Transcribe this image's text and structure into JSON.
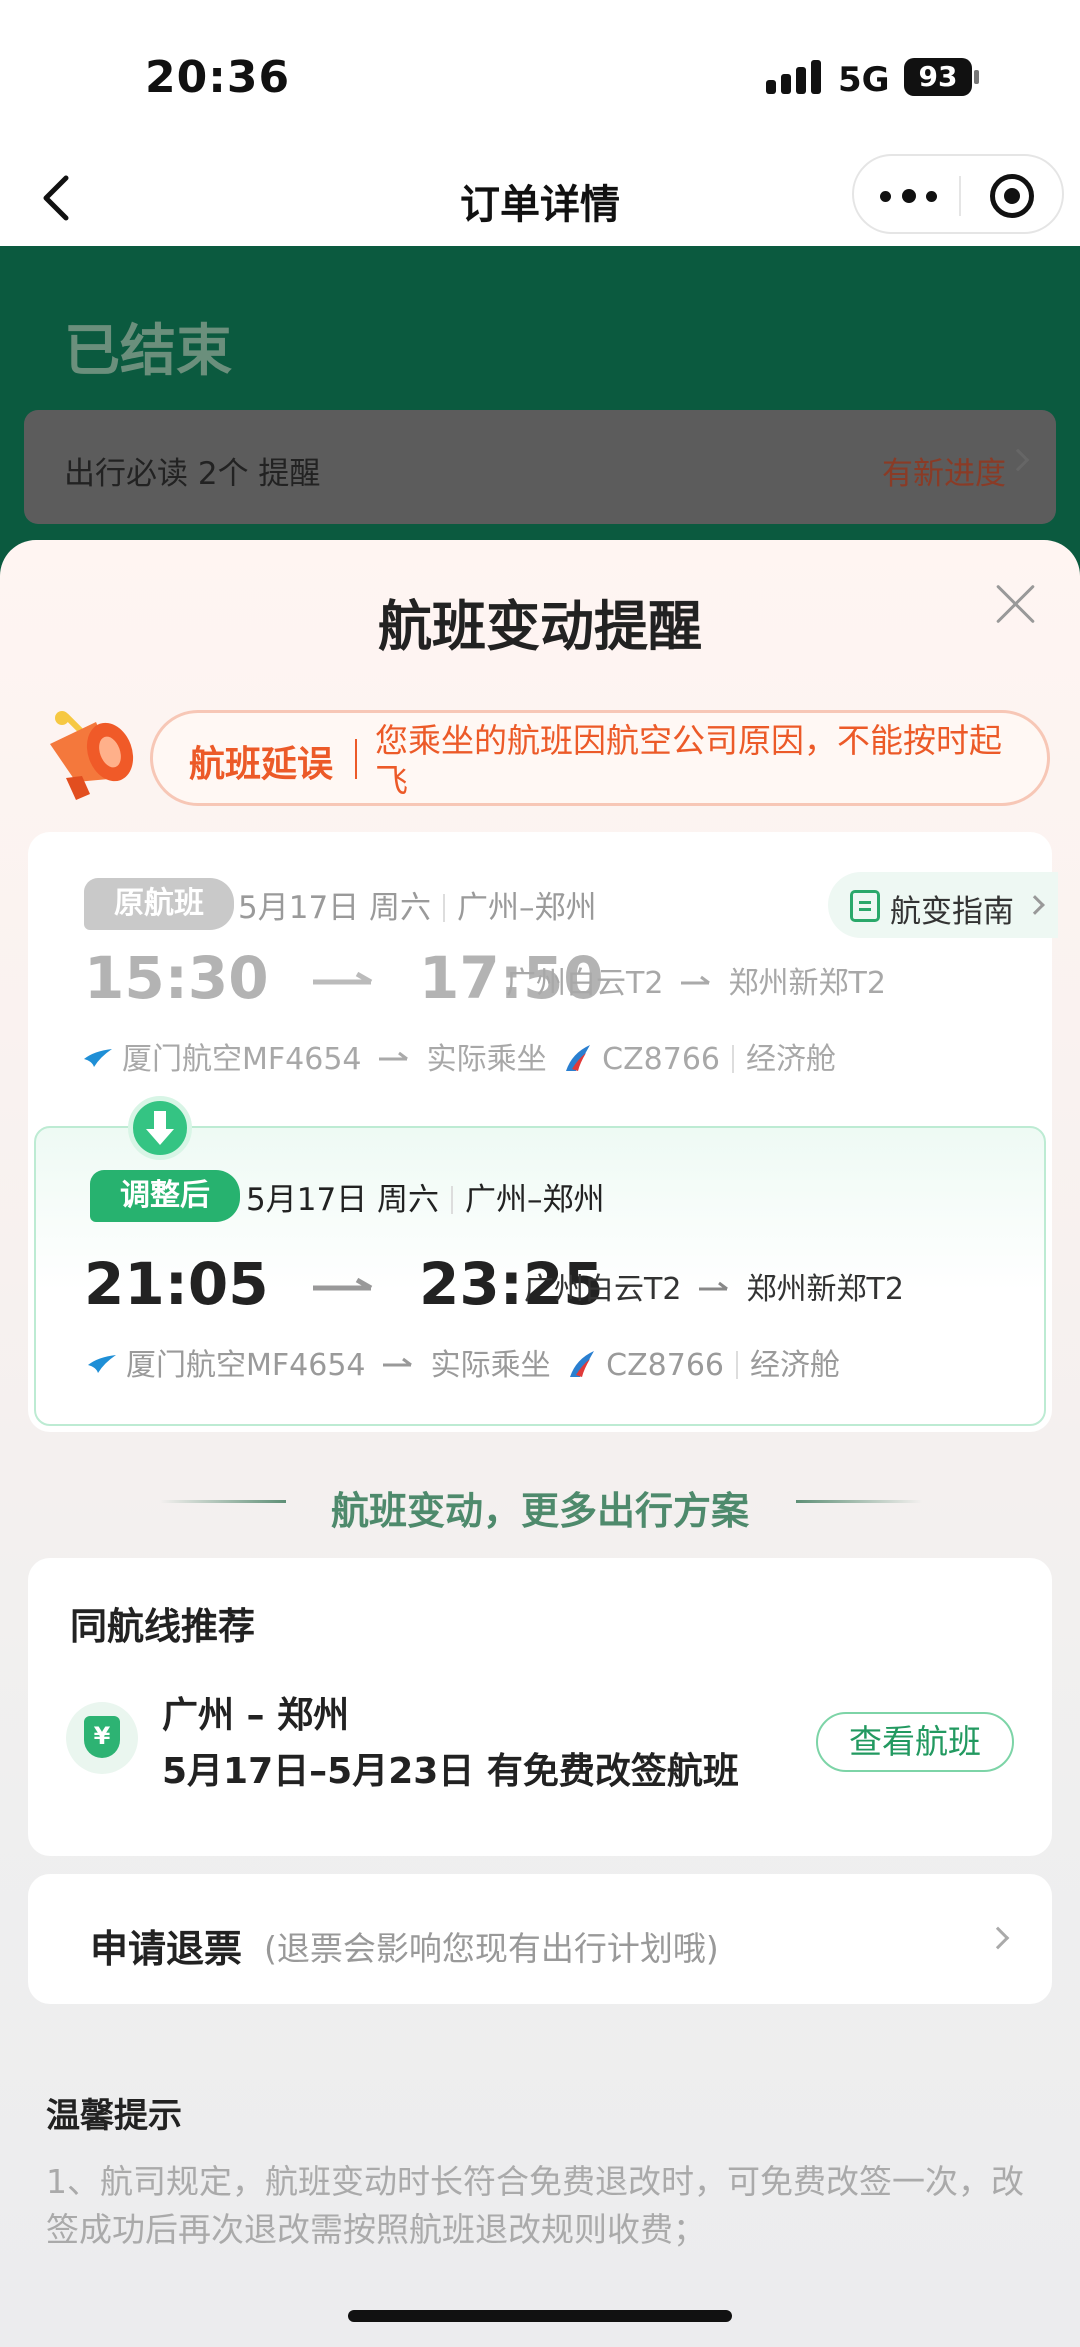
{
  "status_bar": {
    "time": "20:36",
    "network": "5G",
    "battery": "93"
  },
  "nav": {
    "title": "订单详情"
  },
  "order": {
    "status": "已结束",
    "notice": "出行必读 2个 提醒",
    "progress": "有新进度"
  },
  "sheet": {
    "title": "航班变动提醒",
    "delay_tag": "航班延误",
    "delay_text": "您乘坐的航班因航空公司原因，不能按时起飞",
    "original": {
      "tag": "原航班",
      "date": "5月17日 周六",
      "route": "广州–郑州",
      "dep_time": "15:30",
      "arr_time": "17:50",
      "dep_airport": "广州白云T2",
      "arr_airport": "郑州新郑T2",
      "marketing_flight": "厦门航空MF4654",
      "actual_label": "实际乘坐",
      "operating_flight": "CZ8766",
      "cabin": "经济舱"
    },
    "guide": "航变指南",
    "adjusted": {
      "tag": "调整后",
      "date": "5月17日 周六",
      "route": "广州–郑州",
      "dep_time": "21:05",
      "arr_time": "23:25",
      "dep_airport": "广州白云T2",
      "arr_airport": "郑州新郑T2",
      "marketing_flight": "厦门航空MF4654",
      "actual_label": "实际乘坐",
      "operating_flight": "CZ8766",
      "cabin": "经济舱"
    },
    "divider_title": "航班变动，更多出行方案",
    "recommend": {
      "title": "同航线推荐",
      "route": "广州 – 郑州",
      "desc": "5月17日–5月23日 有免费改签航班",
      "button": "查看航班",
      "shield_symbol": "¥"
    },
    "refund": {
      "label": "申请退票",
      "note": "(退票会影响您现有出行计划哦)"
    },
    "tips": {
      "title": "温馨提示",
      "body": "1、航司规定，航班变动时长符合免费退改时，可免费改签一次，改签成功后再次退改需按照航班退改规则收费；"
    }
  },
  "colors": {
    "accent_green": "#27b26f",
    "delay_orange": "#ec5a28",
    "header_green": "#0b5a3f"
  }
}
